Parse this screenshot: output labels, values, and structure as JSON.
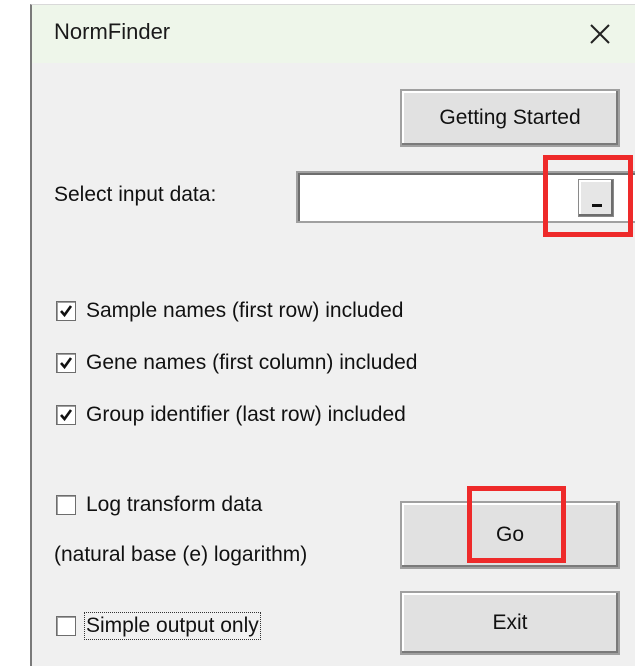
{
  "window": {
    "title": "NormFinder",
    "close_icon": "close-icon"
  },
  "buttons": {
    "getting_started": "Getting Started",
    "go": "Go",
    "exit": "Exit"
  },
  "input": {
    "label": "Select input data:",
    "value": "",
    "picker_icon": "range-select-icon"
  },
  "options": [
    {
      "label": "Sample names (first row) included",
      "checked": true
    },
    {
      "label": "Gene names (first column) included",
      "checked": true
    },
    {
      "label": "Group identifier (last row) included",
      "checked": true
    },
    {
      "label": "Log transform data",
      "checked": false
    },
    {
      "label": "Simple output only",
      "checked": false
    }
  ],
  "log_note": "(natural base (e) logarithm)",
  "colors": {
    "titlebar": "#eef6ea",
    "dialog_bg": "#f0f0f0",
    "highlight": "#ee2a2a"
  }
}
